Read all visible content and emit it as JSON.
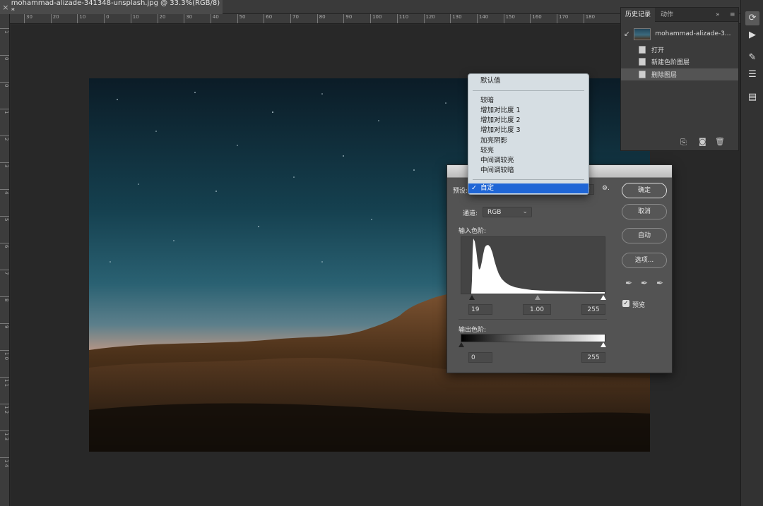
{
  "document": {
    "tab_title": "mohammad-alizade-341348-unsplash.jpg @ 33.3%(RGB/8) *",
    "close_glyph": "×"
  },
  "rulers": {
    "horizontal": [
      "30",
      "20",
      "10",
      "0",
      "10",
      "20",
      "30",
      "40",
      "50",
      "60",
      "70",
      "80",
      "90",
      "100",
      "110",
      "120",
      "130",
      "140",
      "150",
      "160",
      "170",
      "180"
    ],
    "vertical": [
      "1",
      "0",
      "0",
      "1",
      "2",
      "3",
      "4",
      "5",
      "6",
      "7",
      "8",
      "9",
      "1 0",
      "1 1",
      "1 2",
      "1 3",
      "1 4"
    ]
  },
  "history_panel": {
    "tabs": [
      "历史记录",
      "动作"
    ],
    "snapshot": "mohammad-alizade-3...",
    "items": [
      "打开",
      "新建色阶图层",
      "删除图层"
    ],
    "selected_index": 2,
    "bottom_icons": [
      "new-document-from-state-icon",
      "camera-icon",
      "trash-icon"
    ],
    "menu_glyphs": {
      "expand": "»",
      "menu": "≡"
    }
  },
  "right_toolbar": {
    "icons": [
      "history-brush-icon",
      "play-icon",
      "brush-tool-icon",
      "adjustments-icon",
      "properties-icon"
    ]
  },
  "levels_dialog": {
    "preset_label": "预设:",
    "preset_value": "自定",
    "gear_glyph": "⚙.",
    "channel_label": "通道:",
    "channel_value": "RGB",
    "input_label": "输入色阶:",
    "input_black": "19",
    "input_gamma": "1.00",
    "input_white": "255",
    "output_label": "输出色阶:",
    "output_black": "0",
    "output_white": "255",
    "buttons": {
      "ok": "确定",
      "cancel": "取消",
      "auto": "自动",
      "options": "选项..."
    },
    "preview_label": "预览",
    "preview_checked": true,
    "eyedroppers": [
      "black-eyedropper-icon",
      "gray-eyedropper-icon",
      "white-eyedropper-icon"
    ]
  },
  "preset_menu": {
    "top_item": "默认值",
    "items": [
      "较暗",
      "增加对比度 1",
      "增加对比度 2",
      "增加对比度 3",
      "加亮阴影",
      "较亮",
      "中间调较亮",
      "中间调较暗"
    ],
    "selected": "自定",
    "check_glyph": "✓"
  },
  "colors": {
    "menu_highlight": "#1f66d6",
    "panel_bg": "#3b3b3b",
    "dialog_bg": "#535353"
  }
}
